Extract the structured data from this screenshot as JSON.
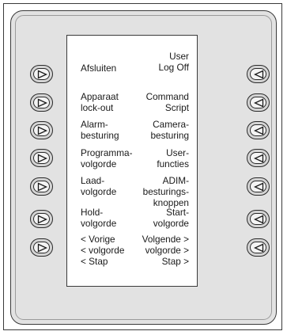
{
  "left_labels": [
    "Afsluiten",
    "Apparaat\nlock-out",
    "Alarm-\nbesturing",
    "Programma-\nvolgorde",
    "Laad-\nvolgorde",
    "Hold-\nvolgorde",
    "< Vorige\n< volgorde\n< Stap"
  ],
  "right_labels": [
    "User\nLog Off",
    "Command\nScript",
    "Camera-\nbesturing",
    "User-\nfuncties",
    "ADIM-\nbesturings-\nknoppen",
    "Start-\nvolgorde",
    "Volgende >\nvolgorde >\nStap >"
  ],
  "icons": {
    "left_button": "triangle-right-icon",
    "right_button": "triangle-left-icon"
  }
}
